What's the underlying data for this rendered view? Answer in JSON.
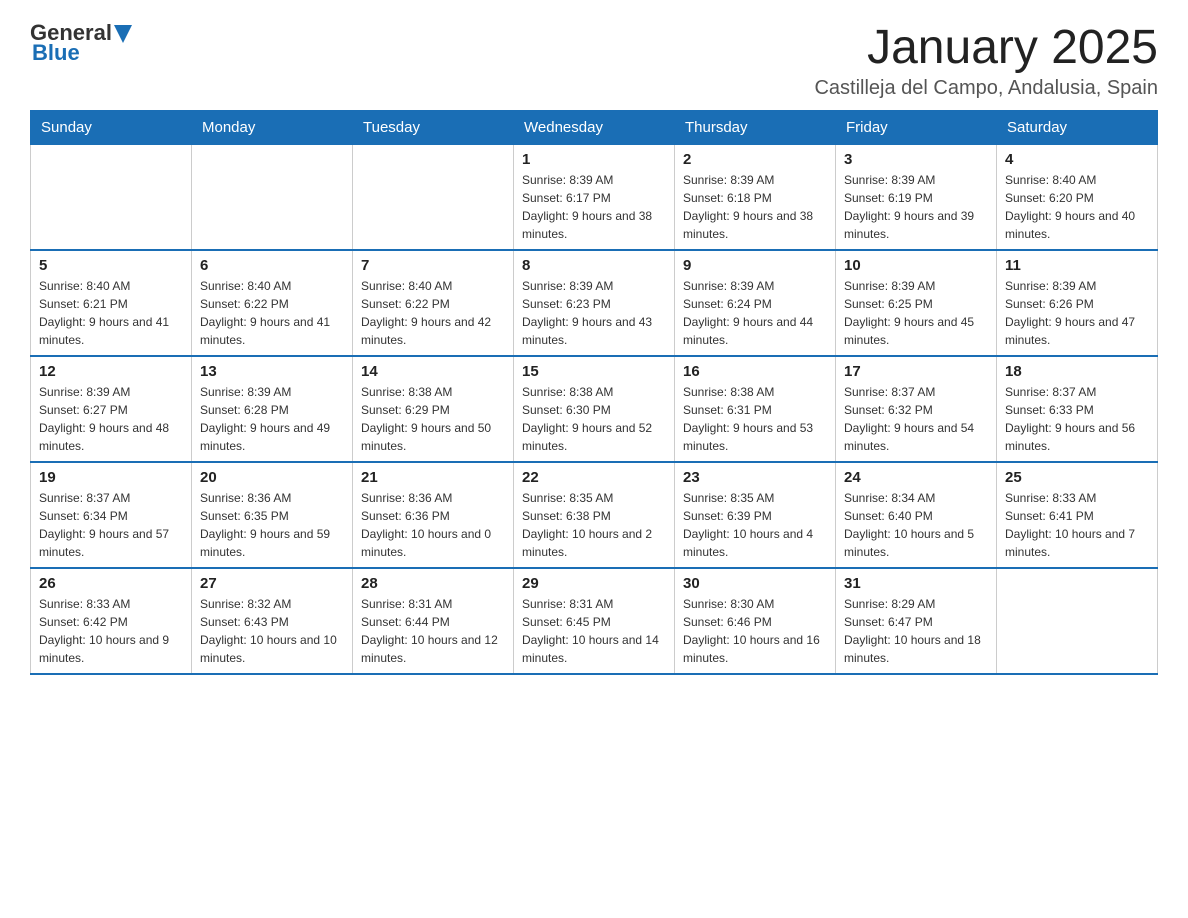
{
  "header": {
    "logo": {
      "general": "General",
      "blue": "Blue"
    },
    "title": "January 2025",
    "location": "Castilleja del Campo, Andalusia, Spain"
  },
  "weekdays": [
    "Sunday",
    "Monday",
    "Tuesday",
    "Wednesday",
    "Thursday",
    "Friday",
    "Saturday"
  ],
  "weeks": [
    [
      {
        "day": "",
        "sunrise": "",
        "sunset": "",
        "daylight": ""
      },
      {
        "day": "",
        "sunrise": "",
        "sunset": "",
        "daylight": ""
      },
      {
        "day": "",
        "sunrise": "",
        "sunset": "",
        "daylight": ""
      },
      {
        "day": "1",
        "sunrise": "Sunrise: 8:39 AM",
        "sunset": "Sunset: 6:17 PM",
        "daylight": "Daylight: 9 hours and 38 minutes."
      },
      {
        "day": "2",
        "sunrise": "Sunrise: 8:39 AM",
        "sunset": "Sunset: 6:18 PM",
        "daylight": "Daylight: 9 hours and 38 minutes."
      },
      {
        "day": "3",
        "sunrise": "Sunrise: 8:39 AM",
        "sunset": "Sunset: 6:19 PM",
        "daylight": "Daylight: 9 hours and 39 minutes."
      },
      {
        "day": "4",
        "sunrise": "Sunrise: 8:40 AM",
        "sunset": "Sunset: 6:20 PM",
        "daylight": "Daylight: 9 hours and 40 minutes."
      }
    ],
    [
      {
        "day": "5",
        "sunrise": "Sunrise: 8:40 AM",
        "sunset": "Sunset: 6:21 PM",
        "daylight": "Daylight: 9 hours and 41 minutes."
      },
      {
        "day": "6",
        "sunrise": "Sunrise: 8:40 AM",
        "sunset": "Sunset: 6:22 PM",
        "daylight": "Daylight: 9 hours and 41 minutes."
      },
      {
        "day": "7",
        "sunrise": "Sunrise: 8:40 AM",
        "sunset": "Sunset: 6:22 PM",
        "daylight": "Daylight: 9 hours and 42 minutes."
      },
      {
        "day": "8",
        "sunrise": "Sunrise: 8:39 AM",
        "sunset": "Sunset: 6:23 PM",
        "daylight": "Daylight: 9 hours and 43 minutes."
      },
      {
        "day": "9",
        "sunrise": "Sunrise: 8:39 AM",
        "sunset": "Sunset: 6:24 PM",
        "daylight": "Daylight: 9 hours and 44 minutes."
      },
      {
        "day": "10",
        "sunrise": "Sunrise: 8:39 AM",
        "sunset": "Sunset: 6:25 PM",
        "daylight": "Daylight: 9 hours and 45 minutes."
      },
      {
        "day": "11",
        "sunrise": "Sunrise: 8:39 AM",
        "sunset": "Sunset: 6:26 PM",
        "daylight": "Daylight: 9 hours and 47 minutes."
      }
    ],
    [
      {
        "day": "12",
        "sunrise": "Sunrise: 8:39 AM",
        "sunset": "Sunset: 6:27 PM",
        "daylight": "Daylight: 9 hours and 48 minutes."
      },
      {
        "day": "13",
        "sunrise": "Sunrise: 8:39 AM",
        "sunset": "Sunset: 6:28 PM",
        "daylight": "Daylight: 9 hours and 49 minutes."
      },
      {
        "day": "14",
        "sunrise": "Sunrise: 8:38 AM",
        "sunset": "Sunset: 6:29 PM",
        "daylight": "Daylight: 9 hours and 50 minutes."
      },
      {
        "day": "15",
        "sunrise": "Sunrise: 8:38 AM",
        "sunset": "Sunset: 6:30 PM",
        "daylight": "Daylight: 9 hours and 52 minutes."
      },
      {
        "day": "16",
        "sunrise": "Sunrise: 8:38 AM",
        "sunset": "Sunset: 6:31 PM",
        "daylight": "Daylight: 9 hours and 53 minutes."
      },
      {
        "day": "17",
        "sunrise": "Sunrise: 8:37 AM",
        "sunset": "Sunset: 6:32 PM",
        "daylight": "Daylight: 9 hours and 54 minutes."
      },
      {
        "day": "18",
        "sunrise": "Sunrise: 8:37 AM",
        "sunset": "Sunset: 6:33 PM",
        "daylight": "Daylight: 9 hours and 56 minutes."
      }
    ],
    [
      {
        "day": "19",
        "sunrise": "Sunrise: 8:37 AM",
        "sunset": "Sunset: 6:34 PM",
        "daylight": "Daylight: 9 hours and 57 minutes."
      },
      {
        "day": "20",
        "sunrise": "Sunrise: 8:36 AM",
        "sunset": "Sunset: 6:35 PM",
        "daylight": "Daylight: 9 hours and 59 minutes."
      },
      {
        "day": "21",
        "sunrise": "Sunrise: 8:36 AM",
        "sunset": "Sunset: 6:36 PM",
        "daylight": "Daylight: 10 hours and 0 minutes."
      },
      {
        "day": "22",
        "sunrise": "Sunrise: 8:35 AM",
        "sunset": "Sunset: 6:38 PM",
        "daylight": "Daylight: 10 hours and 2 minutes."
      },
      {
        "day": "23",
        "sunrise": "Sunrise: 8:35 AM",
        "sunset": "Sunset: 6:39 PM",
        "daylight": "Daylight: 10 hours and 4 minutes."
      },
      {
        "day": "24",
        "sunrise": "Sunrise: 8:34 AM",
        "sunset": "Sunset: 6:40 PM",
        "daylight": "Daylight: 10 hours and 5 minutes."
      },
      {
        "day": "25",
        "sunrise": "Sunrise: 8:33 AM",
        "sunset": "Sunset: 6:41 PM",
        "daylight": "Daylight: 10 hours and 7 minutes."
      }
    ],
    [
      {
        "day": "26",
        "sunrise": "Sunrise: 8:33 AM",
        "sunset": "Sunset: 6:42 PM",
        "daylight": "Daylight: 10 hours and 9 minutes."
      },
      {
        "day": "27",
        "sunrise": "Sunrise: 8:32 AM",
        "sunset": "Sunset: 6:43 PM",
        "daylight": "Daylight: 10 hours and 10 minutes."
      },
      {
        "day": "28",
        "sunrise": "Sunrise: 8:31 AM",
        "sunset": "Sunset: 6:44 PM",
        "daylight": "Daylight: 10 hours and 12 minutes."
      },
      {
        "day": "29",
        "sunrise": "Sunrise: 8:31 AM",
        "sunset": "Sunset: 6:45 PM",
        "daylight": "Daylight: 10 hours and 14 minutes."
      },
      {
        "day": "30",
        "sunrise": "Sunrise: 8:30 AM",
        "sunset": "Sunset: 6:46 PM",
        "daylight": "Daylight: 10 hours and 16 minutes."
      },
      {
        "day": "31",
        "sunrise": "Sunrise: 8:29 AM",
        "sunset": "Sunset: 6:47 PM",
        "daylight": "Daylight: 10 hours and 18 minutes."
      },
      {
        "day": "",
        "sunrise": "",
        "sunset": "",
        "daylight": ""
      }
    ]
  ]
}
